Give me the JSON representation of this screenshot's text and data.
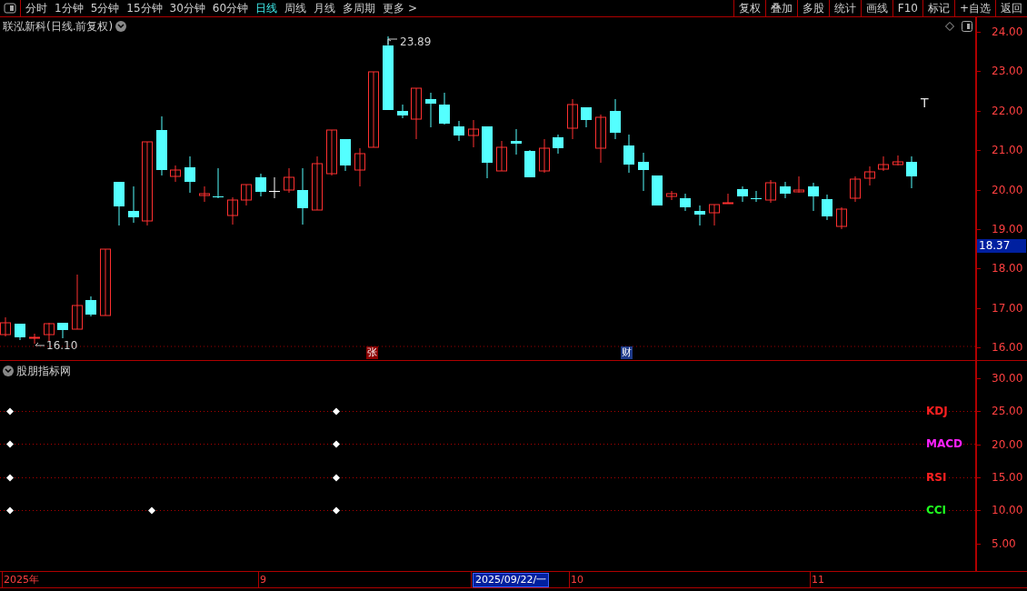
{
  "toolbar": {
    "periods": [
      {
        "label": "分时",
        "selected": false
      },
      {
        "label": "1分钟",
        "selected": false
      },
      {
        "label": "5分钟",
        "selected": false
      },
      {
        "label": "15分钟",
        "selected": false
      },
      {
        "label": "30分钟",
        "selected": false
      },
      {
        "label": "60分钟",
        "selected": false
      },
      {
        "label": "日线",
        "selected": true
      },
      {
        "label": "周线",
        "selected": false
      },
      {
        "label": "月线",
        "selected": false
      },
      {
        "label": "多周期",
        "selected": false
      },
      {
        "label": "更多 >",
        "selected": false
      }
    ],
    "buttons": [
      "复权",
      "叠加",
      "多股",
      "统计",
      "画线",
      "F10",
      "标记",
      "+自选",
      "返回"
    ]
  },
  "price_chart": {
    "title": "联泓新科(日线.前复权)",
    "high_label": "23.89",
    "low_label": "16.10",
    "marker": "T",
    "yticks": [
      "24.00",
      "23.00",
      "22.00",
      "21.00",
      "20.00",
      "19.00",
      "18.00",
      "17.00",
      "16.00"
    ],
    "current_price": "18.37",
    "events": [
      {
        "label": "张",
        "color": "#8b0000"
      },
      {
        "label": "财",
        "color": "#1e3a8a"
      }
    ]
  },
  "indicator_panel": {
    "title": "股朋指标网",
    "yticks": [
      "30.00",
      "25.00",
      "20.00",
      "15.00",
      "10.00",
      "5.00"
    ],
    "signals": [
      {
        "label": "KDJ",
        "color": "#ff2020"
      },
      {
        "label": "MACD",
        "color": "#ff20ff"
      },
      {
        "label": "RSI",
        "color": "#ff2020"
      },
      {
        "label": "CCI",
        "color": "#20ff20"
      }
    ]
  },
  "timeline": [
    {
      "label": "2025年",
      "selected": false
    },
    {
      "label": "9",
      "selected": false
    },
    {
      "label": "2025/09/22/一",
      "selected": true
    },
    {
      "label": "10",
      "selected": false
    },
    {
      "label": "11",
      "selected": false
    }
  ]
}
